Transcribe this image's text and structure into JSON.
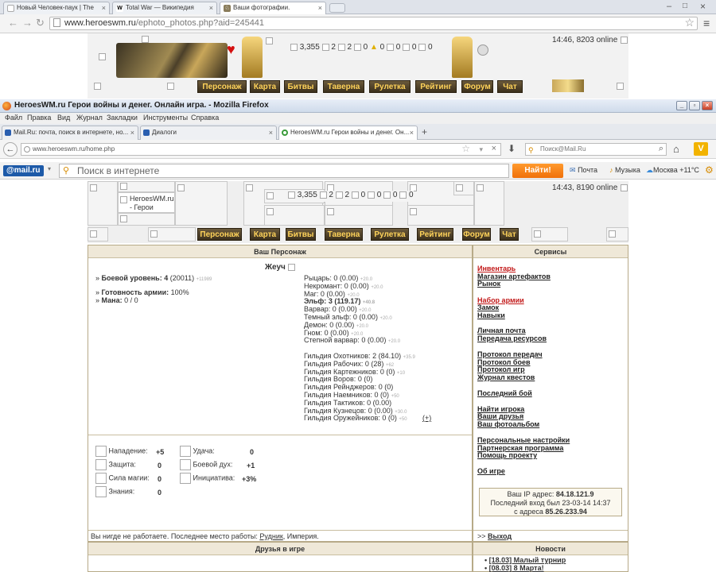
{
  "outer_browser": {
    "tabs": [
      {
        "label": "Новый Человек-паук | The",
        "active": false
      },
      {
        "label": "Total War — Википедия",
        "active": false
      },
      {
        "label": "Ваши фотографии.",
        "active": true
      }
    ],
    "url_domain": "www.heroeswm.ru",
    "url_path": "/ephoto_photos.php?aid=245441",
    "window_buttons": [
      "–",
      "□",
      "×"
    ]
  },
  "outer_game": {
    "time_online": "14:46, 8203 online",
    "stats": [
      "3,355",
      "2",
      "2",
      "0",
      "0",
      "0",
      "0",
      "0"
    ],
    "nav": [
      "Персонаж",
      "Карта",
      "Битвы",
      "Таверна",
      "Рулетка",
      "Рейтинг",
      "Форум",
      "Чат"
    ]
  },
  "inner_window": {
    "title": "HeroesWM.ru Герои войны и денег. Онлайн игра. - Mozilla Firefox",
    "menu": [
      "Файл",
      "Правка",
      "Вид",
      "Журнал",
      "Закладки",
      "Инструменты",
      "Справка"
    ],
    "tabs": [
      {
        "label": "Mail.Ru: почта, поиск в интернете, но...",
        "active": false
      },
      {
        "label": "Диалоги",
        "active": false
      },
      {
        "label": "HeroesWM.ru Герои войны и денег. Он...",
        "active": true
      }
    ],
    "url": "www.heroeswm.ru/home.php",
    "search_placeholder": "Поиск@Mail.Ru",
    "mail_logo": "@mail.ru",
    "mail_search_placeholder": "Поиск в интернете",
    "mail_button": "Найти!",
    "mail_links": [
      "Почта",
      "Музыка",
      "Москва +11°C"
    ]
  },
  "inner_game": {
    "logo_text": "HeroesWM.ru - Герои",
    "time_online": "14:43, 8190 online",
    "stats": [
      "3,355",
      "2",
      "2",
      "0",
      "0",
      "0",
      "0"
    ],
    "nav": [
      "Персонаж",
      "Карта",
      "Битвы",
      "Таверна",
      "Рулетка",
      "Рейтинг",
      "Форум",
      "Чат"
    ]
  },
  "character": {
    "panel_title": "Ваш Персонаж",
    "name": "Жеуч",
    "combat_level_label": "Боевой уровень:",
    "combat_level": "4",
    "combat_exp": "(20011)",
    "combat_next": "+11989",
    "army_label": "Готовность армии:",
    "army_value": "100%",
    "mana_label": "Мана:",
    "mana_value": "0 / 0",
    "factions": [
      {
        "name": "Рыцарь:",
        "value": "0 (0.00)",
        "next": "+20.0"
      },
      {
        "name": "Некромант:",
        "value": "0 (0.00)",
        "next": "+20.0"
      },
      {
        "name": "Маг:",
        "value": "0 (0.00)",
        "next": "+20.0"
      },
      {
        "name": "Эльф:",
        "value": "3 (119.17)",
        "next": "+40.8",
        "bold": true
      },
      {
        "name": "Варвар:",
        "value": "0 (0.00)",
        "next": "+20.0"
      },
      {
        "name": "Темный эльф:",
        "value": "0 (0.00)",
        "next": "+20.0"
      },
      {
        "name": "Демон:",
        "value": "0 (0.00)",
        "next": "+20.0"
      },
      {
        "name": "Гном:",
        "value": "0 (0.00)",
        "next": "+20.0"
      },
      {
        "name": "Степной варвар:",
        "value": "0 (0.00)",
        "next": "+20.0"
      }
    ],
    "guilds": [
      {
        "name": "Гильдия Охотников:",
        "value": "2 (84.10)",
        "next": "+35.9"
      },
      {
        "name": "Гильдия Рабочих:",
        "value": "0 (28)",
        "next": "+62"
      },
      {
        "name": "Гильдия Картежников:",
        "value": "0 (0)",
        "next": "+10"
      },
      {
        "name": "Гильдия Воров:",
        "value": "0 (0)",
        "next": ""
      },
      {
        "name": "Гильдия Рейнджеров:",
        "value": "0 (0)",
        "next": ""
      },
      {
        "name": "Гильдия Наемников:",
        "value": "0 (0)",
        "next": "+50"
      },
      {
        "name": "Гильдия Тактиков:",
        "value": "0 (0.00)",
        "next": ""
      },
      {
        "name": "Гильдия Кузнецов:",
        "value": "0 (0.00)",
        "next": "+30.0"
      },
      {
        "name": "Гильдия Оружейников:",
        "value": "0 (0)",
        "next": "+50"
      }
    ],
    "expand": "(+)",
    "stats_left": [
      {
        "name": "Нападение:",
        "value": "+5"
      },
      {
        "name": "Защита:",
        "value": "0"
      },
      {
        "name": "Сила магии:",
        "value": "0"
      },
      {
        "name": "Знания:",
        "value": "0"
      }
    ],
    "stats_right": [
      {
        "name": "Удача:",
        "value": "0"
      },
      {
        "name": "Боевой дух:",
        "value": "+1"
      },
      {
        "name": "Инициатива:",
        "value": "+3%"
      }
    ],
    "work_prefix": "Вы нигде не работаете. Последнее место работы:",
    "work_link": "Рудник",
    "work_suffix": ", Империя."
  },
  "services": {
    "title": "Сервисы",
    "links": [
      {
        "label": "Инвентарь",
        "red": true
      },
      {
        "label": "Магазин артефактов"
      },
      {
        "label": "Рынок"
      },
      {
        "label": "Набор армии",
        "red": true
      },
      {
        "label": "Замок"
      },
      {
        "label": "Навыки"
      },
      {
        "label": "Личная почта"
      },
      {
        "label": "Передача ресурсов"
      },
      {
        "label": "Протокол передач"
      },
      {
        "label": "Протокол боев"
      },
      {
        "label": "Протокол игр"
      },
      {
        "label": "Журнал квестов"
      },
      {
        "label": "Последний бой"
      },
      {
        "label": "Найти игрока"
      },
      {
        "label": "Ваши друзья"
      },
      {
        "label": "Ваш фотоальбом"
      },
      {
        "label": "Персональные настройки"
      },
      {
        "label": "Партнерская программа"
      },
      {
        "label": "Помощь проекту"
      },
      {
        "label": "Об игре"
      }
    ],
    "ip_label": "Ваш IP адрес:",
    "ip_value": "84.18.121.9",
    "last_login": "Последний вход был 23-03-14 14:37",
    "from_label": "с адреса",
    "from_value": "85.26.233.94",
    "logout_prefix": ">>",
    "logout": "Выход"
  },
  "friends": {
    "title": "Друзья в игре"
  },
  "news": {
    "title": "Новости",
    "items": [
      "[18.03] Малый турнир",
      "[08.03] 8 Марта!"
    ]
  }
}
